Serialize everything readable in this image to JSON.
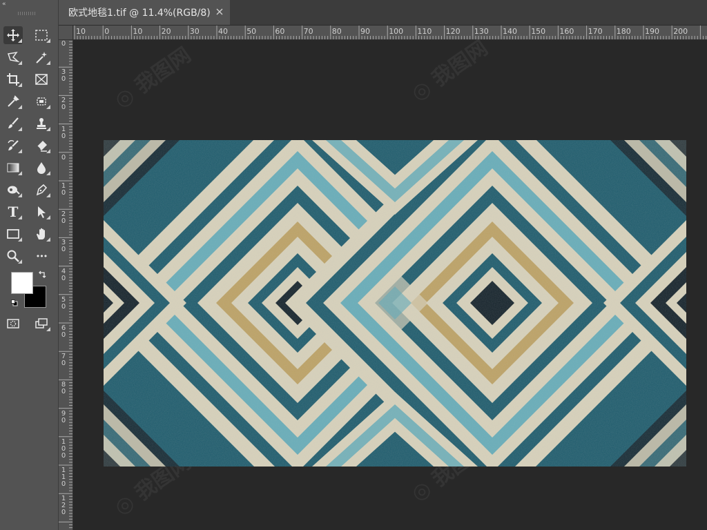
{
  "document": {
    "tab_title": "欧式地毯1.tif @ 11.4%(RGB/8)"
  },
  "toolbar": {
    "collapse_label": "«",
    "tools": [
      {
        "name": "move-tool",
        "icon": "move-icon",
        "active": true
      },
      {
        "name": "marquee-tool",
        "icon": "rectangular-marquee-icon"
      },
      {
        "name": "lasso-tool",
        "icon": "polygonal-lasso-icon"
      },
      {
        "name": "magic-wand-tool",
        "icon": "magic-wand-icon"
      },
      {
        "name": "crop-tool",
        "icon": "crop-icon"
      },
      {
        "name": "frame-tool",
        "icon": "frame-icon"
      },
      {
        "name": "eyedropper-tool",
        "icon": "eyedropper-icon"
      },
      {
        "name": "healing-brush-tool",
        "icon": "healing-brush-icon"
      },
      {
        "name": "brush-tool",
        "icon": "brush-icon"
      },
      {
        "name": "clone-stamp-tool",
        "icon": "clone-stamp-icon"
      },
      {
        "name": "history-brush-tool",
        "icon": "history-brush-icon"
      },
      {
        "name": "eraser-tool",
        "icon": "eraser-icon"
      },
      {
        "name": "gradient-tool",
        "icon": "gradient-icon"
      },
      {
        "name": "blur-tool",
        "icon": "blur-drop-icon"
      },
      {
        "name": "dodge-tool",
        "icon": "dodge-icon"
      },
      {
        "name": "pen-tool",
        "icon": "pen-icon"
      },
      {
        "name": "type-tool",
        "icon": "type-icon",
        "label": "T"
      },
      {
        "name": "path-selection-tool",
        "icon": "arrow-icon"
      },
      {
        "name": "rectangle-tool",
        "icon": "rectangle-icon"
      },
      {
        "name": "hand-tool",
        "icon": "hand-icon"
      },
      {
        "name": "zoom-tool",
        "icon": "zoom-icon"
      },
      {
        "name": "more-tools",
        "icon": "more-icon",
        "label": "•••"
      },
      {
        "name": "quick-mask",
        "icon": "quick-mask-icon"
      },
      {
        "name": "screen-mode",
        "icon": "screen-mode-icon"
      }
    ],
    "foreground_color": "#ffffff",
    "background_color": "#000000"
  },
  "ruler_top": [
    "10",
    "0",
    "10",
    "20",
    "30",
    "40",
    "50",
    "60",
    "70",
    "80",
    "90",
    "100",
    "110",
    "120",
    "130",
    "140",
    "150",
    "160",
    "170",
    "180",
    "190",
    "200"
  ],
  "ruler_left": [
    "0",
    "30",
    "20",
    "10",
    "0",
    "10",
    "20",
    "30",
    "40",
    "50",
    "60",
    "70",
    "80",
    "90",
    "100",
    "110",
    "120"
  ],
  "canvas": {
    "colors": {
      "teal": "#1d5b6c",
      "light_teal": "#5aa9b9",
      "cream": "#d8d2bb",
      "tan": "#b89a55",
      "dark": "#14222a"
    }
  }
}
